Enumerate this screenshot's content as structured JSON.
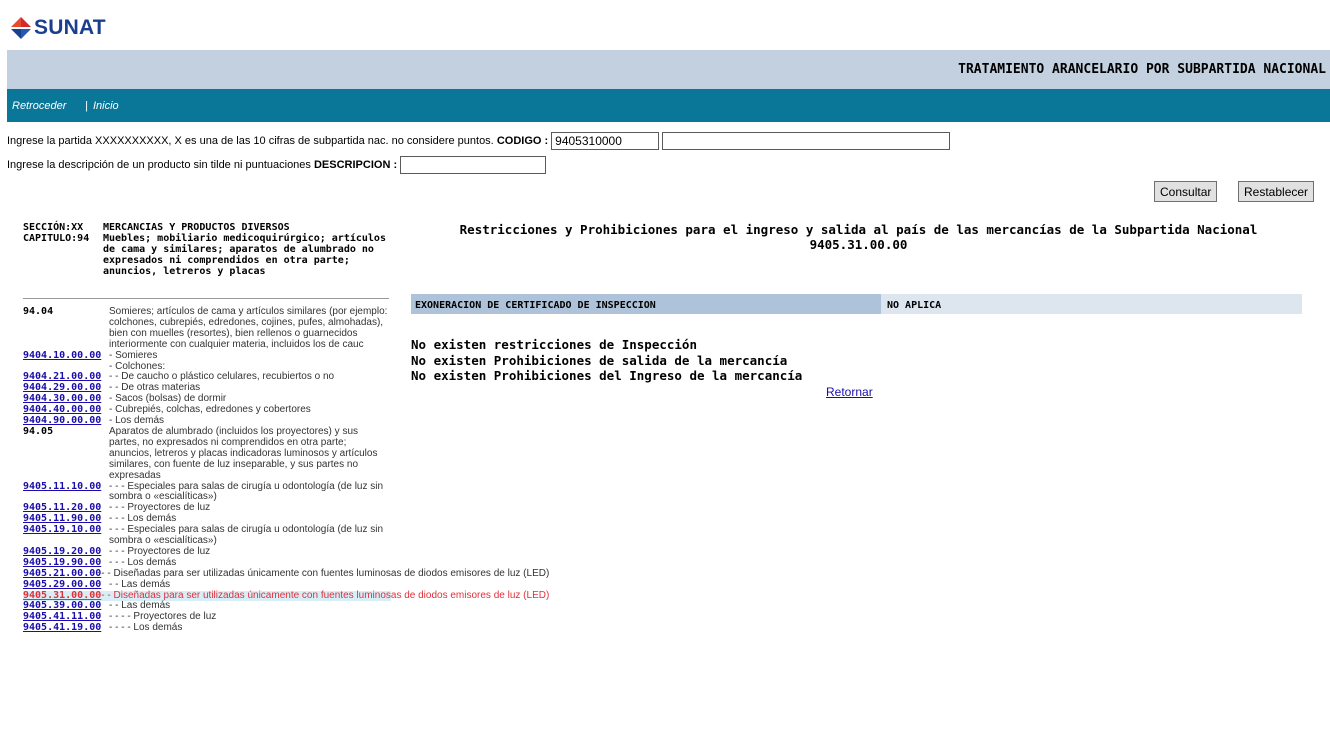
{
  "logo": {
    "text": "SUNAT",
    "brand_blue": "#1b3f8f",
    "brand_red": "#d32b2b"
  },
  "header": {
    "title": "TRATAMIENTO ARANCELARIO POR SUBPARTIDA NACIONAL"
  },
  "nav": {
    "back": "Retroceder",
    "separator": "|",
    "home": "Inicio"
  },
  "form": {
    "codigo_prompt": "Ingrese la partida XXXXXXXXXX, X es una de las 10 cifras de subpartida nac. no considere puntos.",
    "codigo_label": "CODIGO :",
    "codigo_value": "9405310000",
    "extra_value": "",
    "descripcion_prompt": "Ingrese la descripción de un producto sin tilde ni puntuaciones",
    "descripcion_label": "DESCRIPCION :",
    "descripcion_value": "",
    "consultar": "Consultar",
    "restablecer": "Restablecer"
  },
  "section": {
    "seccion_label": "SECCIÓN:XX",
    "seccion_text": "MERCANCIAS Y PRODUCTOS DIVERSOS",
    "capitulo_label": "CAPITULO:94",
    "capitulo_text": "Muebles; mobiliario medicoquirúrgico; artículos de cama y similares; aparatos de alumbrado no expresados ni comprendidos en otra parte; anuncios, letreros y placas"
  },
  "tariff_list": [
    {
      "code": "94.04",
      "heading": true,
      "desc": "Somieres; artículos de cama y artículos similares (por ejemplo: colchones, cubrepiés, edredones, cojines, pufes, almohadas), bien con muelles (resortes), bien rellenos o guarnecidos interiormente con cualquier materia, incluidos los de cauc"
    },
    {
      "code": "9404.10.00.00",
      "desc": "- Somieres"
    },
    {
      "code": "",
      "desc": "- Colchones:"
    },
    {
      "code": "9404.21.00.00",
      "desc": "- - De caucho o plástico celulares, recubiertos o no"
    },
    {
      "code": "9404.29.00.00",
      "desc": "- - De otras materias"
    },
    {
      "code": "9404.30.00.00",
      "desc": "- Sacos (bolsas) de dormir"
    },
    {
      "code": "9404.40.00.00",
      "desc": "- Cubrepiés, colchas, edredones y cobertores"
    },
    {
      "code": "9404.90.00.00",
      "desc": "- Los demás"
    },
    {
      "code": "94.05",
      "heading": true,
      "desc": "Aparatos de alumbrado (incluidos los proyectores) y sus partes, no expresados ni comprendidos en otra parte; anuncios, letreros y placas indicadoras luminosos y artículos similares, con fuente de luz inseparable, y sus partes no expresadas"
    },
    {
      "code": "9405.11.10.00",
      "desc": "- - - Especiales para salas de cirugía u odontología (de luz sin sombra o «escialíticas»)"
    },
    {
      "code": "9405.11.20.00",
      "desc": "- - - Proyectores de luz"
    },
    {
      "code": "9405.11.90.00",
      "desc": "- - - Los demás"
    },
    {
      "code": "9405.19.10.00",
      "desc": "- - - Especiales para salas de cirugía u odontología (de luz sin sombra o «escialíticas»)"
    },
    {
      "code": "9405.19.20.00",
      "desc": "- - - Proyectores de luz"
    },
    {
      "code": "9405.19.90.00",
      "desc": "- - - Los demás"
    },
    {
      "code": "9405.21.00.00",
      "desc": "- - Diseñadas para ser utilizadas únicamente con fuentes luminosas de diodos emisores de luz (LED)",
      "wide": true
    },
    {
      "code": "9405.29.00.00",
      "desc": "- - Las demás"
    },
    {
      "code": "9405.31.00.00",
      "desc": "- - Diseñadas para ser utilizadas únicamente con fuentes luminosas de diodos emisores de luz (LED)",
      "wide": true,
      "selected": true
    },
    {
      "code": "9405.39.00.00",
      "desc": "- - Las demás"
    },
    {
      "code": "9405.41.11.00",
      "desc": "- - - - Proyectores de luz"
    },
    {
      "code": "9405.41.19.00",
      "desc": "- - - - Los demás"
    }
  ],
  "main": {
    "title_line1": "Restricciones y Prohibiciones para el ingreso y salida al país de las mercancías de la Subpartida Nacional",
    "title_line2": "9405.31.00.00",
    "inspection_label": "EXONERACION DE CERTIFICADO DE INSPECCION",
    "inspection_value": "NO APLICA",
    "messages": [
      "No existen restricciones de Inspección",
      "No existen Prohibiciones de salida de la mercancía",
      "No existen Prohibiciones del Ingreso de la mercancía"
    ],
    "retornar": "Retornar"
  }
}
